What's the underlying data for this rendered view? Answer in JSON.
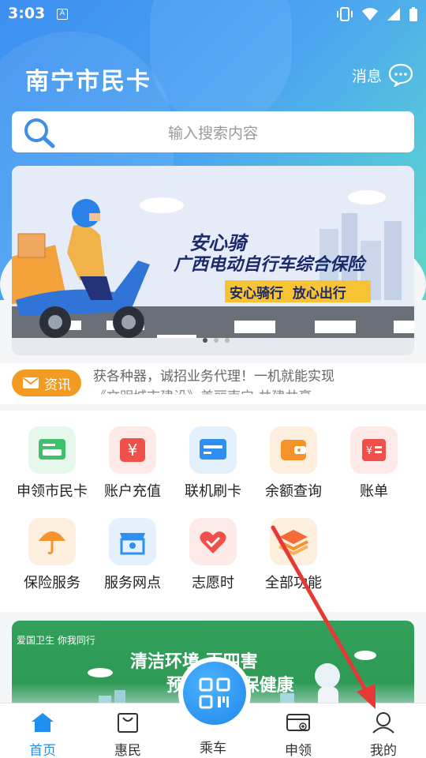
{
  "status_bar": {
    "time": "3:03",
    "notif_letter": "A"
  },
  "header": {
    "title": "南宁市民卡",
    "message_label": "消息"
  },
  "search": {
    "placeholder": "输入搜索内容"
  },
  "banner": {
    "headline": "安心骑",
    "subline": "广西电动自行车综合保险",
    "slogan": "安心骑行  放心出行",
    "dots": 3,
    "active_dot": 0
  },
  "news": {
    "tag": "资讯",
    "line1": "获各种器，诚招业务代理！一机就能实现",
    "line2": "《文明城市建设》美丽南宁 共建共享"
  },
  "services": [
    {
      "label": "申领市民卡",
      "icon": "card-apply-icon",
      "color": "#3fbf6a",
      "bg": "#e6f7ec"
    },
    {
      "label": "账户充值",
      "icon": "recharge-icon",
      "color": "#f0504a",
      "bg": "#fde9e8"
    },
    {
      "label": "联机刷卡",
      "icon": "swipe-card-icon",
      "color": "#2e8ff0",
      "bg": "#e4f1fd"
    },
    {
      "label": "余额查询",
      "icon": "wallet-icon",
      "color": "#f5922a",
      "bg": "#fdeedd"
    },
    {
      "label": "账单",
      "icon": "bill-icon",
      "color": "#f0504a",
      "bg": "#fde9e8"
    },
    {
      "label": "保险服务",
      "icon": "umbrella-icon",
      "color": "#f5922a",
      "bg": "#fdeedd"
    },
    {
      "label": "服务网点",
      "icon": "store-location-icon",
      "color": "#2e8ff0",
      "bg": "#e4f1fd"
    },
    {
      "label": "志愿时",
      "icon": "heart-hand-icon",
      "color": "#f0504a",
      "bg": "#fde9e8"
    },
    {
      "label": "全部功能",
      "icon": "layers-icon",
      "color": "#f56a3a",
      "bg": "#fdeedd"
    }
  ],
  "promo": {
    "badge": "爱国卫生 你我同行",
    "title": "清洁环境 灭四害",
    "subtitle": "预防疾病 保健康"
  },
  "tabbar": {
    "items": [
      {
        "label": "首页",
        "icon": "home-icon",
        "active": true
      },
      {
        "label": "惠民",
        "icon": "bag-icon",
        "active": false
      },
      {
        "label": "乘车",
        "icon": "qr-code-icon",
        "active": false
      },
      {
        "label": "申领",
        "icon": "card-add-icon",
        "active": false
      },
      {
        "label": "我的",
        "icon": "user-icon",
        "active": false
      }
    ]
  },
  "colors": {
    "primary": "#1f8ff0",
    "news_tag": "#f39a20",
    "annotation_arrow": "#e53935"
  }
}
